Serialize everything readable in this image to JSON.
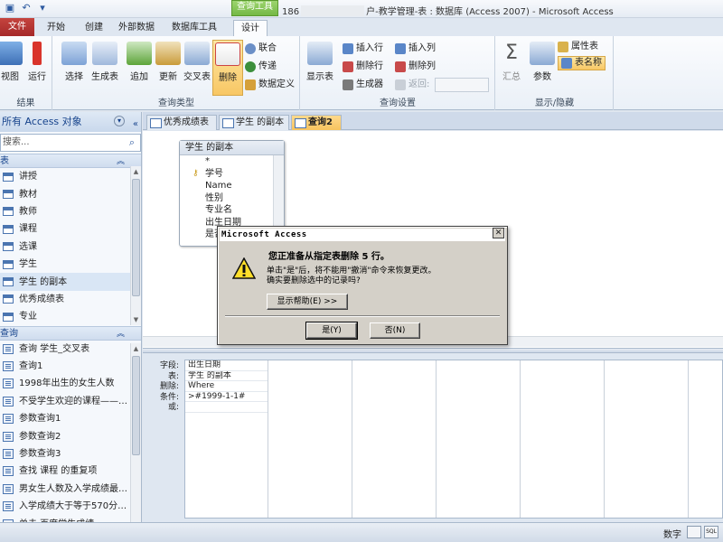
{
  "window": {
    "title_prefix": "186",
    "title_main": "户-教学管理-表 : 数据库 (Access 2007)  -  Microsoft Access",
    "context_tab_group": "查询工具"
  },
  "ribbon_tabs": [
    "文件",
    "开始",
    "创建",
    "外部数据",
    "数据库工具",
    "设计"
  ],
  "ribbon": {
    "results": {
      "label": "结果",
      "view": "视图",
      "run": "运行"
    },
    "query_type": {
      "label": "查询类型",
      "select": "选择",
      "make_table": "生成表",
      "append": "追加",
      "update": "更新",
      "crosstab": "交叉表",
      "delete": "删除",
      "union": "联合",
      "pass_through": "传递",
      "data_definition": "数据定义"
    },
    "query_setup": {
      "label": "查询设置",
      "show_table": "显示表",
      "insert_rows": "插入行",
      "delete_rows": "删除行",
      "builder": "生成器",
      "insert_columns": "插入列",
      "delete_columns": "删除列",
      "return": "返回:"
    },
    "show_hide": {
      "label": "显示/隐藏",
      "totals": "汇总",
      "parameters": "参数",
      "property_sheet": "属性表",
      "table_names": "表名称"
    }
  },
  "nav": {
    "header": "所有 Access 对象",
    "search_placeholder": "搜索...",
    "tables_section": "表",
    "tables": [
      "讲授",
      "教材",
      "教师",
      "课程",
      "选课",
      "学生",
      "学生 的副本",
      "优秀成绩表",
      "专业"
    ],
    "queries_section": "查询",
    "queries": [
      "查询 学生_交叉表",
      "查询1",
      "1998年出生的女生人数",
      "不受学生欢迎的课程——…",
      "参数查询1",
      "参数查询2",
      "参数查询3",
      "查找 课程 的重复项",
      "男女生人数及入学成绩最…",
      "入学成绩大于等于570分…",
      "单击 百度学生成绩"
    ]
  },
  "doc_tabs": [
    "优秀成绩表",
    "学生 的副本",
    "查询2"
  ],
  "field_list": {
    "title": "学生 的副本",
    "fields": [
      "*",
      "学号",
      "Name",
      "性别",
      "专业名",
      "出生日期",
      "是否"
    ]
  },
  "grid": {
    "row_labels": [
      "字段:",
      "表:",
      "删除:",
      "条件:",
      "或:"
    ],
    "column1": [
      "出生日期",
      "学生 的副本",
      "Where",
      ">#1999-1-1#",
      ""
    ]
  },
  "dialog": {
    "title": "Microsoft Access",
    "message": "您正准备从指定表删除 5 行。",
    "detail_line1": "单击\"是\"后，将不能用\"撤消\"命令来恢复更改。",
    "detail_line2": "确实要删除选中的记录吗?",
    "help_button": "显示帮助(E) >>",
    "yes_button": "是(Y)",
    "no_button": "否(N)"
  },
  "status": {
    "mode": "数字"
  },
  "colors": {
    "file_tab": "#b8322f",
    "highlight": "#f8c764",
    "context_tab": "#74b844"
  }
}
